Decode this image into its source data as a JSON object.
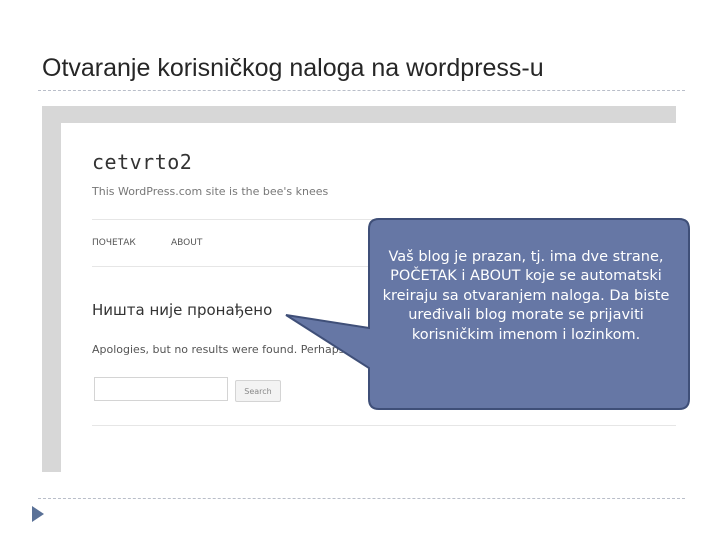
{
  "slide": {
    "title": "Otvaranje korisničkog naloga na wordpress-u"
  },
  "wordpress": {
    "site_title": "cetvrto2",
    "tagline": "This WordPress.com site is the bee's knees",
    "nav": [
      "ПОЧЕТАК",
      "ABOUT"
    ],
    "heading": "Ништа није пронађено",
    "message": "Apologies, but no results were found. Perhaps searching will help find a related post.",
    "search_placeholder": "",
    "search_button": "Search"
  },
  "callout": {
    "text": "Vaš blog je prazan, tj. ima dve strane, POČETAK i ABOUT koje se automatski kreiraju sa otvaranjem naloga. Da biste uređivali blog morate se prijaviti korisničkim imenom i lozinkom.",
    "fill": "#6677a5",
    "stroke": "#3f4f78"
  },
  "colors": {
    "bullet": "#5a7197",
    "rule": "#b9bec9"
  },
  "icons": {
    "bullet": "triangle-right-icon"
  }
}
